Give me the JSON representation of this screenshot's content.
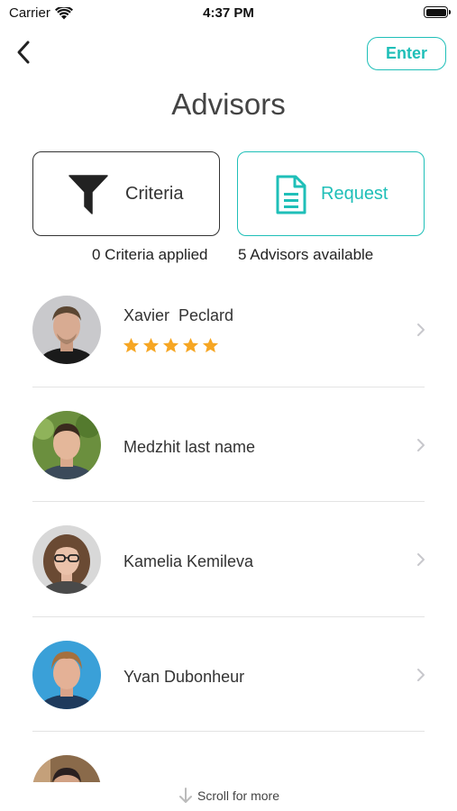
{
  "status_bar": {
    "carrier": "Carrier",
    "time": "4:37 PM",
    "icons": [
      "wifi-icon",
      "battery-icon"
    ]
  },
  "header": {
    "back_icon": "chevron-left-icon",
    "enter_label": "Enter",
    "title": "Advisors"
  },
  "actions": {
    "criteria": {
      "label": "Criteria",
      "icon": "filter-icon",
      "status": "0 Criteria applied"
    },
    "request": {
      "label": "Request",
      "icon": "document-icon",
      "status": "5 Advisors available"
    }
  },
  "advisors": [
    {
      "name": "Xavier  Peclard",
      "rating": 5,
      "avatar": "avatar-photo"
    },
    {
      "name": "Medzhit last name",
      "avatar": "avatar-photo"
    },
    {
      "name": "Kamelia Kemileva",
      "avatar": "avatar-photo"
    },
    {
      "name": "Yvan Dubonheur",
      "avatar": "avatar-photo"
    },
    {
      "name": "",
      "avatar": "avatar-photo"
    }
  ],
  "footer": {
    "scroll_hint": "Scroll for more",
    "icon": "arrow-down-icon"
  },
  "colors": {
    "accent": "#1fbfb8",
    "star": "#f6a623",
    "text": "#333333",
    "divider": "#e3e3e3"
  }
}
